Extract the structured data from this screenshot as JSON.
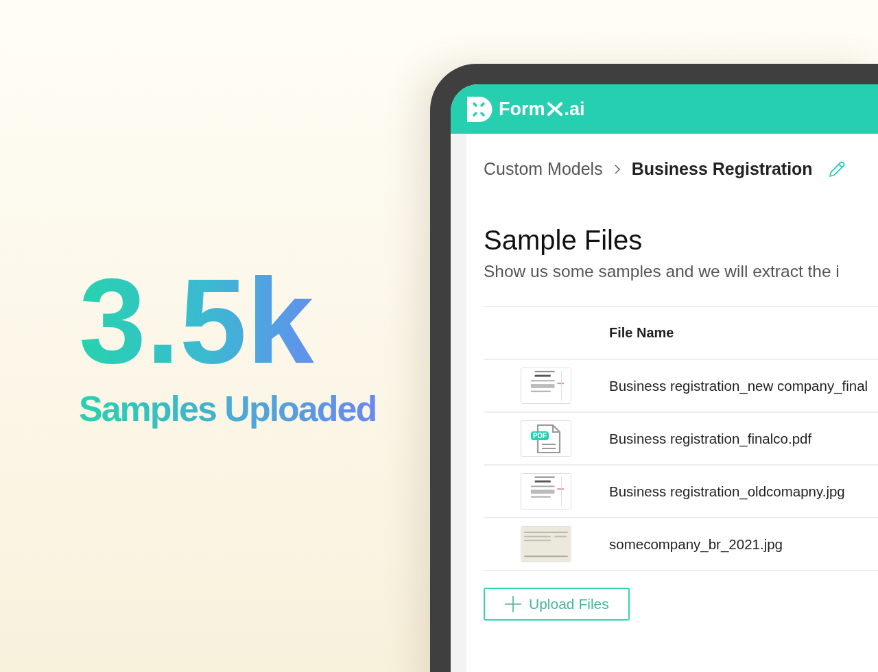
{
  "promo": {
    "stat": "3.5k",
    "caption": "Samples Uploaded"
  },
  "app": {
    "brand": {
      "name_start": "Form",
      "name_end": ".ai"
    },
    "breadcrumb": {
      "parent": "Custom Models",
      "current": "Business Registration"
    },
    "heading": "Sample Files",
    "subtitle": "Show us some samples and we will extract the i",
    "table": {
      "columns": [
        "File Name"
      ],
      "rows": [
        {
          "kind": "picture",
          "file_name": "Business registration_new company_final"
        },
        {
          "kind": "pdf",
          "badge": "PDF",
          "file_name": "Business registration_finalco.pdf"
        },
        {
          "kind": "picture",
          "file_name": "Business registration_oldcomapny.jpg"
        },
        {
          "kind": "picture",
          "file_name": "somecompany_br_2021.jpg"
        }
      ]
    },
    "upload_button": "Upload Files"
  }
}
